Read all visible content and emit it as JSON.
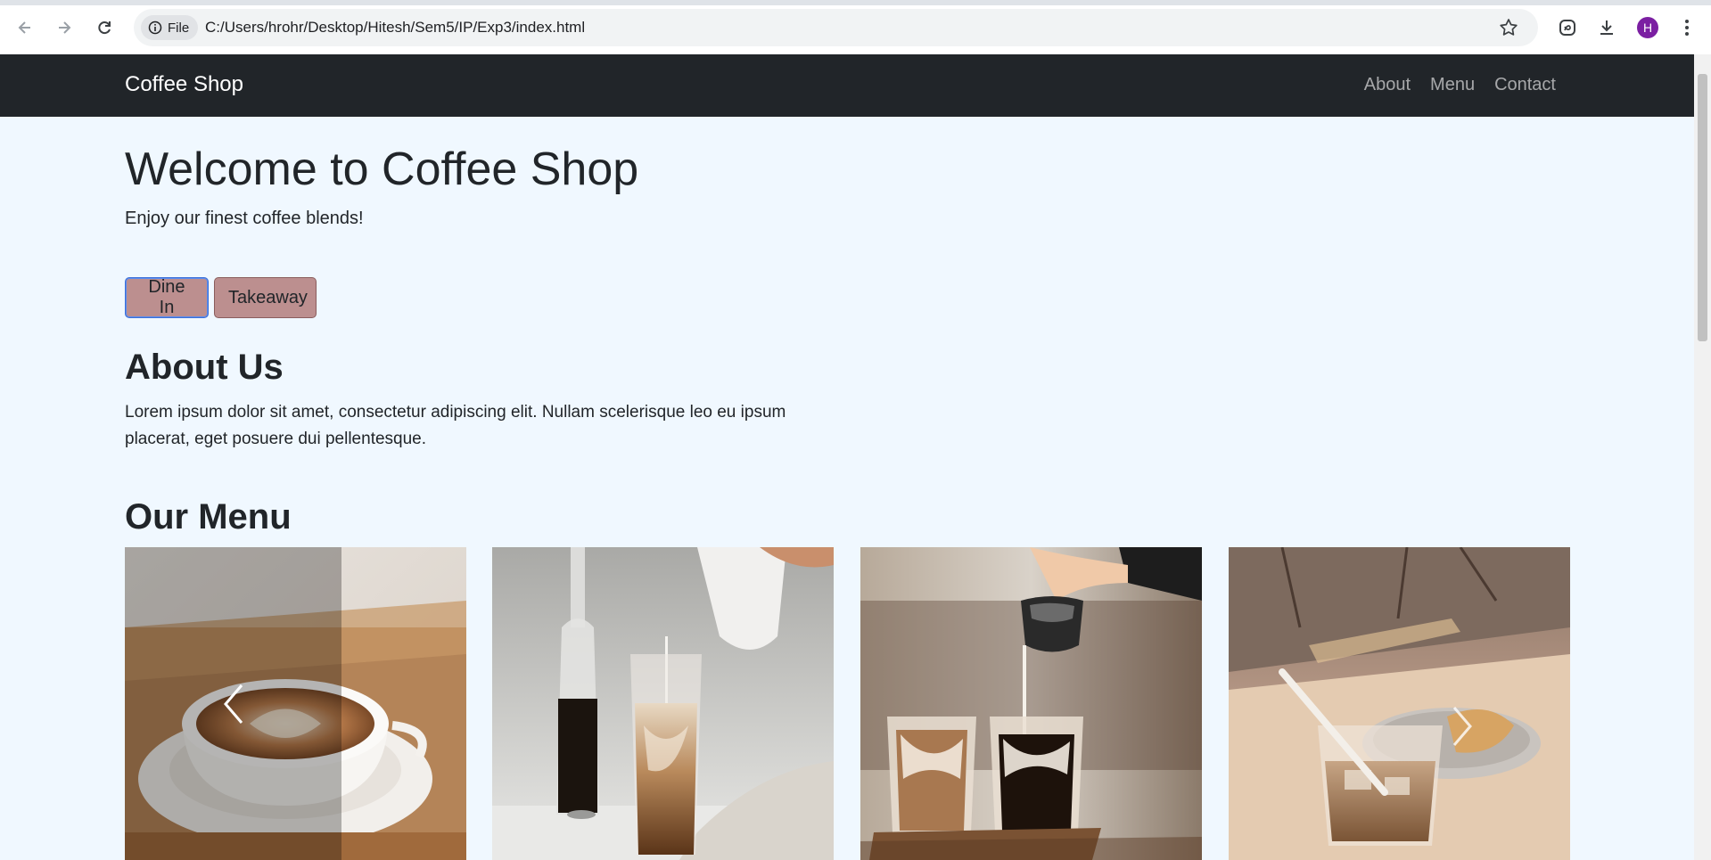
{
  "browser": {
    "chip_label": "File",
    "url": "C:/Users/hrohr/Desktop/Hitesh/Sem5/IP/Exp3/index.html",
    "profile_initial": "H",
    "colors": {
      "profile": "#7b1fa2"
    }
  },
  "navbar": {
    "brand": "Coffee Shop",
    "links": [
      "About",
      "Menu",
      "Contact"
    ]
  },
  "hero": {
    "title": "Welcome to Coffee Shop",
    "subtitle": "Enjoy our finest coffee blends!",
    "buttons": {
      "dine_in": "Dine In",
      "takeaway": "Takeaway"
    }
  },
  "about": {
    "title": "About Us",
    "text": "Lorem ipsum dolor sit amet, consectetur adipiscing elit. Nullam scelerisque leo eu ipsum placerat, eget posuere dui pellentesque."
  },
  "menu": {
    "title": "Our Menu",
    "images": [
      "latte-art-cup",
      "iced-latte-pour",
      "iced-coffee-pair-pour",
      "iced-coffee-with-pastry"
    ]
  },
  "colors": {
    "page_bg": "#f0f8ff",
    "navbar_bg": "#212529",
    "button_bg": "#bc8f8f"
  }
}
